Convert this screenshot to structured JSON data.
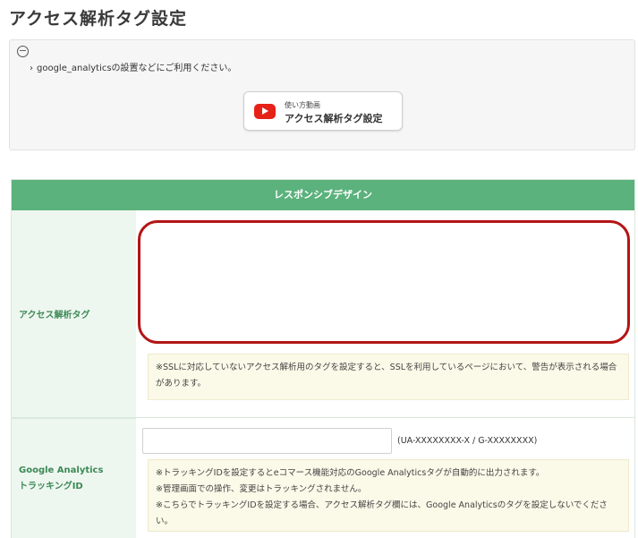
{
  "page": {
    "title": "アクセス解析タグ設定"
  },
  "info": {
    "collapse_symbol": "−",
    "chevron": "›",
    "text": "google_analyticsの設置などにご利用ください。",
    "video_button": {
      "sub_label": "使い方動画",
      "main_label": "アクセス解析タグ設定"
    }
  },
  "table": {
    "header": "レスポンシブデザイン",
    "rows": [
      {
        "label": "アクセス解析タグ",
        "textarea_value": "",
        "note": "※SSLに対応していないアクセス解析用のタグを設定すると、SSLを利用しているページにおいて、警告が表示される場合があります。"
      },
      {
        "label_line1": "Google Analytics",
        "label_line2": "トラッキングID",
        "input_value": "",
        "hint": "(UA-XXXXXXXX-X / G-XXXXXXXX)",
        "notes": [
          "※トラッキングIDを設定するとeコマース機能対応のGoogle Analyticsタグが自動的に出力されます。",
          "※管理画面での操作、変更はトラッキングされません。",
          "※こちらでトラッキングIDを設定する場合、アクセス解析タグ欄には、Google Analyticsのタグを設定しないでください。"
        ]
      }
    ]
  },
  "colors": {
    "header_green": "#5bb27c",
    "label_green": "#3c8a55",
    "highlight_red": "#b31515",
    "note_bg": "#fbf9e8"
  },
  "icons": {
    "collapse": "minus-circle-icon",
    "video": "youtube-play-icon"
  }
}
